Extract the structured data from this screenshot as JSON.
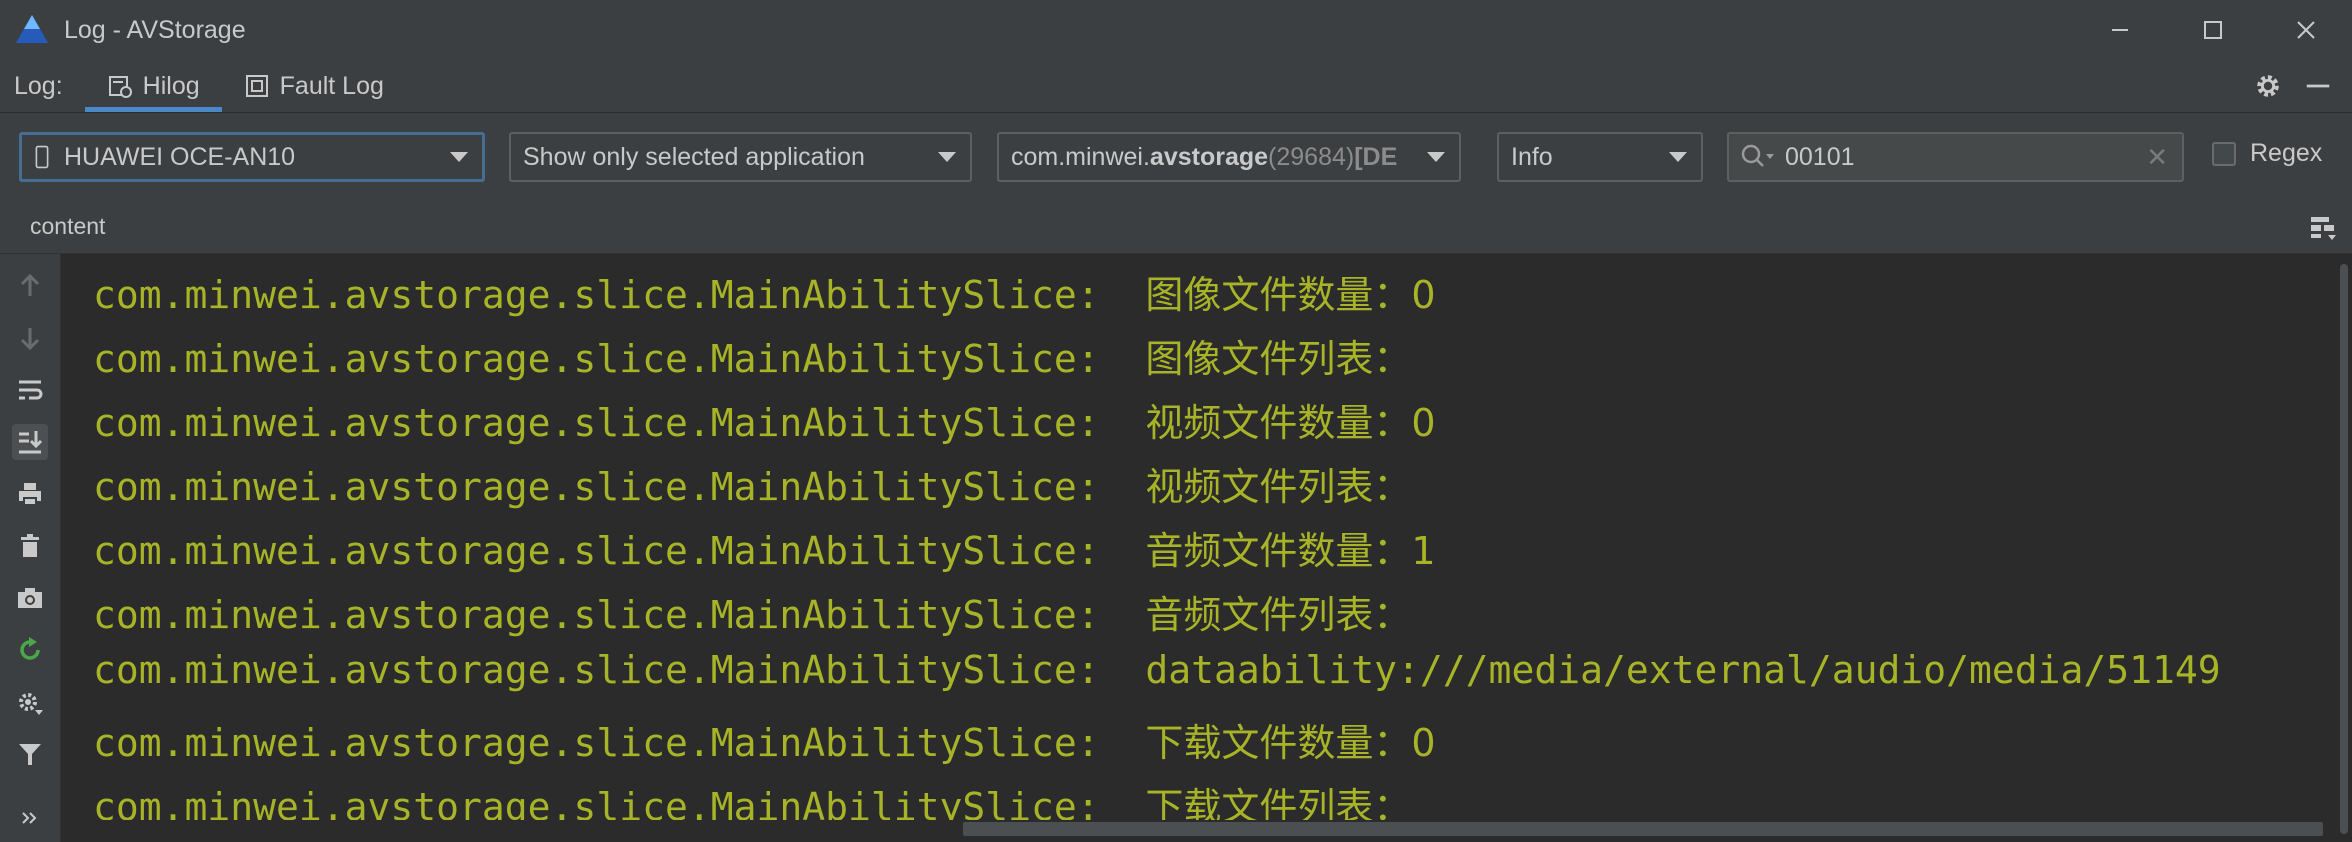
{
  "window": {
    "title": "Log - AVStorage",
    "controls": [
      "minimize",
      "maximize",
      "close"
    ]
  },
  "logbar": {
    "label": "Log:",
    "tabs": [
      {
        "label": "Hilog",
        "icon": "hilog-icon",
        "active": true
      },
      {
        "label": "Fault Log",
        "icon": "fault-log-icon",
        "active": false
      }
    ]
  },
  "toolbar": {
    "device": "HUAWEI OCE-AN10",
    "filter_mode": "Show only selected application",
    "process_prefix": "com.minwei.",
    "process_bold": "avstorage",
    "process_pid": " (29684) ",
    "process_suffix": "[DE",
    "level": "Info",
    "search_value": "00101",
    "regex_label": "Regex",
    "regex_checked": false
  },
  "columns": {
    "content_label": "content"
  },
  "log_lines": [
    {
      "tag": "com.minwei.avstorage.slice.MainAbilitySlice:  ",
      "msg": "图像文件数量：0"
    },
    {
      "tag": "com.minwei.avstorage.slice.MainAbilitySlice:  ",
      "msg": "图像文件列表："
    },
    {
      "tag": "com.minwei.avstorage.slice.MainAbilitySlice:  ",
      "msg": "视频文件数量：0"
    },
    {
      "tag": "com.minwei.avstorage.slice.MainAbilitySlice:  ",
      "msg": "视频文件列表："
    },
    {
      "tag": "com.minwei.avstorage.slice.MainAbilitySlice:  ",
      "msg": "音频文件数量：1"
    },
    {
      "tag": "com.minwei.avstorage.slice.MainAbilitySlice:  ",
      "msg": "音频文件列表："
    },
    {
      "tag": "com.minwei.avstorage.slice.MainAbilitySlice:  ",
      "msg": "dataability:///media/external/audio/media/51149"
    },
    {
      "tag": "com.minwei.avstorage.slice.MainAbilitySlice:  ",
      "msg": "下载文件数量：0"
    },
    {
      "tag": "com.minwei.avstorage.slice.MainAbilitySlice:  ",
      "msg": "下载文件列表："
    }
  ],
  "sidebar_icons": [
    "scroll-up-icon",
    "scroll-down-icon",
    "soft-wrap-icon",
    "scroll-to-end-icon",
    "print-icon",
    "trash-icon",
    "screenshot-icon",
    "restart-icon",
    "settings-icon",
    "filter-icon",
    "more-icon"
  ],
  "colors": {
    "log_text": "#a8b427",
    "accent": "#4a88c7",
    "background": "#2b2b2b",
    "panel": "#3c3f41"
  }
}
